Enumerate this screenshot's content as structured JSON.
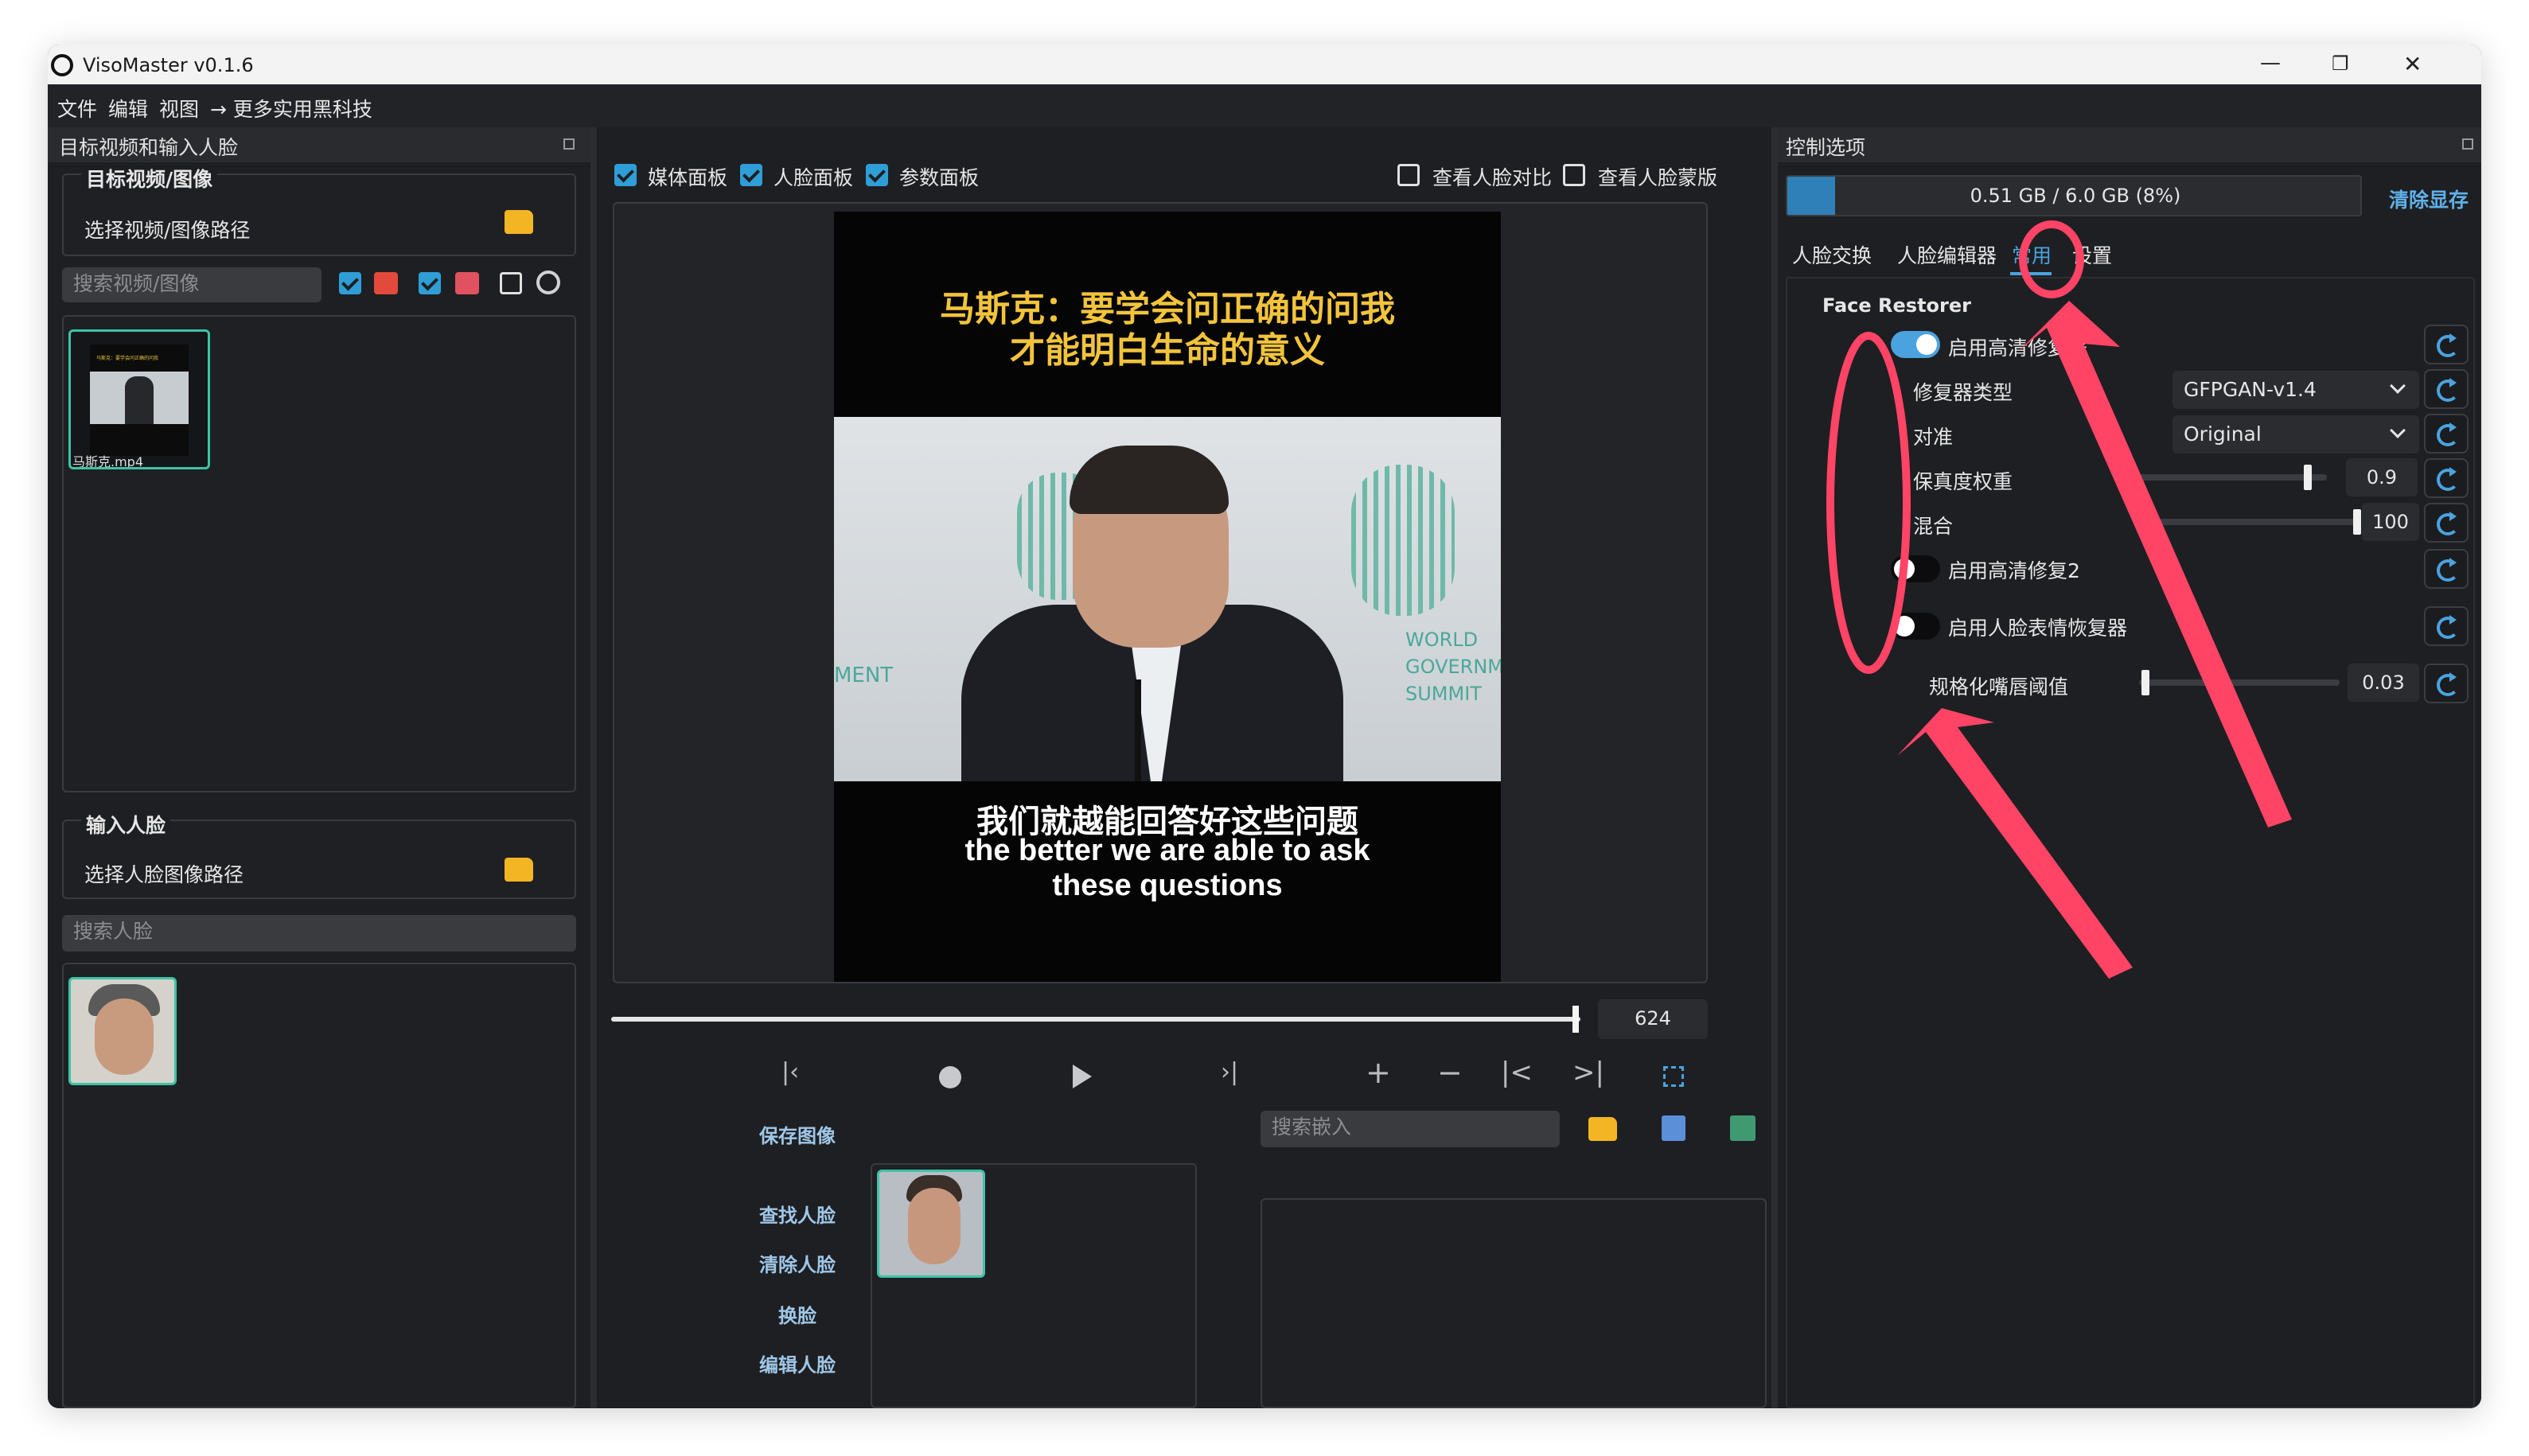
{
  "window": {
    "title": "VisoMaster v0.1.6",
    "controls": {
      "minimize": "—",
      "maximize": "❐",
      "close": "✕"
    }
  },
  "menu": [
    "文件",
    "编辑",
    "视图",
    "→ 更多实用黑科技"
  ],
  "left_panel": {
    "header": "目标视频和输入人脸",
    "target_section": {
      "title": "目标视频/图像",
      "path_label": "选择视频/图像路径",
      "search_placeholder": "搜索视频/图像",
      "thumbnail_caption": "马斯克.mp4",
      "thumbnail_text": "马斯克：要学会问正确的问我"
    },
    "face_section": {
      "title": "输入人脸",
      "path_label": "选择人脸图像路径",
      "search_placeholder": "搜索人脸"
    }
  },
  "center_panel": {
    "checkboxes": [
      {
        "label": "媒体面板",
        "checked": true
      },
      {
        "label": "人脸面板",
        "checked": true
      },
      {
        "label": "参数面板",
        "checked": true
      }
    ],
    "right_checkboxes": [
      {
        "label": "查看人脸对比",
        "checked": false
      },
      {
        "label": "查看人脸蒙版",
        "checked": false
      }
    ],
    "video": {
      "caption_top_line1": "马斯克：要学会问正确的问我",
      "caption_top_line2": "才能明白生命的意义",
      "backdrop_left": "MENT",
      "backdrop_world": "WORLD",
      "backdrop_gov": "GOVERNMEN",
      "backdrop_summit": "SUMMIT",
      "subtitle_cn": "我们就越能回答好这些问题",
      "subtitle_en1": "the better we are able to ask",
      "subtitle_en2": "these questions"
    },
    "frame_number": "624",
    "timeline_position": 0.995,
    "side_actions": [
      "保存图像",
      "查找人脸",
      "清除人脸",
      "换脸",
      "编辑人脸"
    ],
    "embedding_search_placeholder": "搜索嵌入"
  },
  "right_panel": {
    "header": "控制选项",
    "memory": {
      "text": "0.51 GB / 6.0 GB (8%)",
      "fraction": 0.08
    },
    "clear_memory": "清除显存",
    "tabs": [
      "人脸交换",
      "人脸编辑器",
      "常用",
      "设置"
    ],
    "active_tab": "常用",
    "section_title": "Face Restorer",
    "rows": {
      "enable_restorer": {
        "label": "启用高清修复器",
        "on": true
      },
      "restorer_type": {
        "label": "修复器类型",
        "value": "GFPGAN-v1.4"
      },
      "alignment": {
        "label": "对准",
        "value": "Original"
      },
      "fidelity": {
        "label": "保真度权重",
        "value": "0.9",
        "level": 0.9
      },
      "blend": {
        "label": "混合",
        "value": "100",
        "level": 1.0
      },
      "enable_restorer2": {
        "label": "启用高清修复2",
        "on": false
      },
      "enable_expression": {
        "label": "启用人脸表情恢复器",
        "on": false
      },
      "mouth_threshold": {
        "label": "规格化嘴唇阈值",
        "value": "0.03",
        "level": 0.03
      }
    }
  },
  "colors": {
    "accent": "#2f9ed6",
    "annotation": "#ff4466",
    "window_bg": "#1e1f22"
  }
}
